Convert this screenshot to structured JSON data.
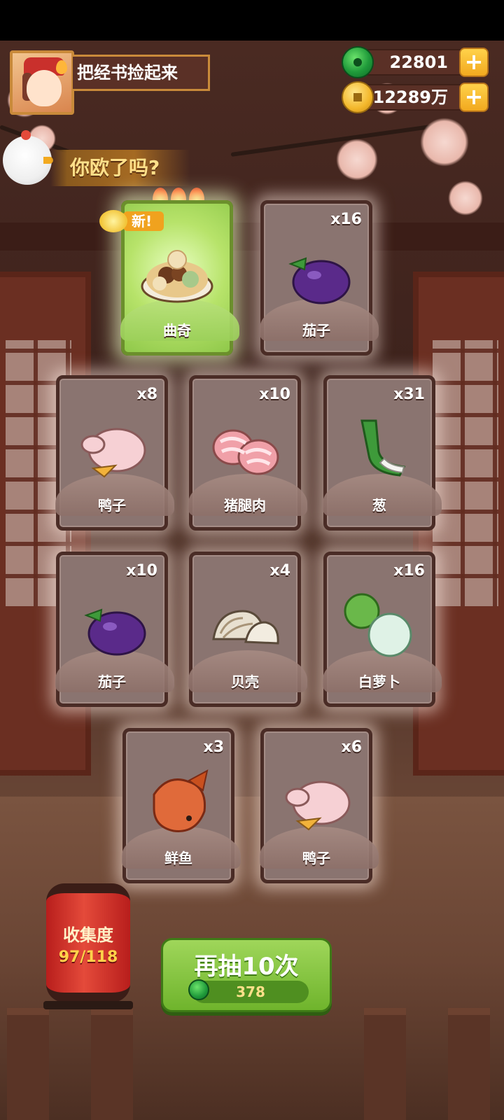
{
  "header": {
    "quest_title": "把经书捡起来",
    "jade_amount": "22801",
    "coin_amount": "12289万",
    "plus_label": "+"
  },
  "banner": {
    "luck_text": "你欧了吗?"
  },
  "new_tag": "新!",
  "cards": [
    {
      "name": "曲奇",
      "count": "",
      "icon": "cookie-dish-icon",
      "special": true
    },
    {
      "name": "茄子",
      "count": "x16",
      "icon": "eggplant-icon"
    },
    {
      "name": "鸭子",
      "count": "x8",
      "icon": "duck-icon"
    },
    {
      "name": "猪腿肉",
      "count": "x10",
      "icon": "pork-leg-icon"
    },
    {
      "name": "葱",
      "count": "x31",
      "icon": "green-onion-icon"
    },
    {
      "name": "茄子",
      "count": "x10",
      "icon": "eggplant-icon"
    },
    {
      "name": "贝壳",
      "count": "x4",
      "icon": "clam-icon"
    },
    {
      "name": "白萝卜",
      "count": "x16",
      "icon": "white-radish-icon"
    },
    {
      "name": "鲜鱼",
      "count": "x3",
      "icon": "fish-icon"
    },
    {
      "name": "鸭子",
      "count": "x6",
      "icon": "duck-icon"
    }
  ],
  "collection": {
    "label": "收集度",
    "progress": "97/118"
  },
  "draw_button": {
    "label": "再抽10次",
    "cost": "378"
  },
  "colors": {
    "special_card": "#b7e36a",
    "card": "#8a7470",
    "draw_button": "#6fb42c",
    "lantern": "#e44a3a"
  }
}
